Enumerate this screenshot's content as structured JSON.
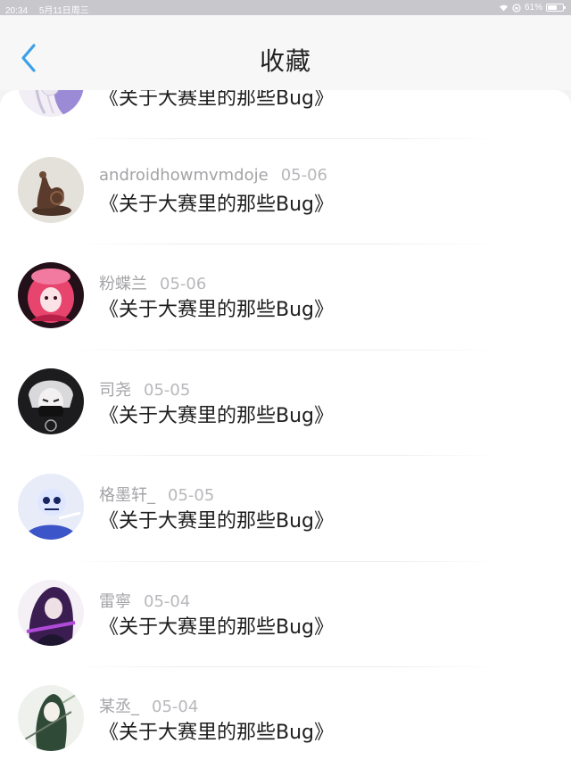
{
  "status_bar": {
    "time": "20:34",
    "date": "5月11日周三",
    "battery": "61%",
    "battery_level": 0.61
  },
  "nav": {
    "title": "收藏"
  },
  "colors": {
    "accent": "#3aa0e8",
    "meta_text": "#a4a4a8",
    "content_text": "#1e1e1e"
  },
  "items": [
    {
      "username": "",
      "date": "",
      "content": "《关于大赛里的那些Bug》",
      "avatar": "lavender-sketch"
    },
    {
      "username": "androidhowmvmdoje",
      "date": "05-06",
      "content": "《关于大赛里的那些Bug》",
      "avatar": "wood-snail"
    },
    {
      "username": "粉蝶兰",
      "date": "05-06",
      "content": "《关于大赛里的那些Bug》",
      "avatar": "pink-hair-girl"
    },
    {
      "username": "司尧",
      "date": "05-05",
      "content": "《关于大赛里的那些Bug》",
      "avatar": "masked-white-hair"
    },
    {
      "username": "格墨轩_",
      "date": "05-05",
      "content": "《关于大赛里的那些Bug》",
      "avatar": "blue-skeleton"
    },
    {
      "username": "雷寧",
      "date": "05-04",
      "content": "《关于大赛里的那些Bug》",
      "avatar": "purple-hair-character"
    },
    {
      "username": "某丞_",
      "date": "05-04",
      "content": "《关于大赛里的那些Bug》",
      "avatar": "green-ink-character"
    }
  ]
}
